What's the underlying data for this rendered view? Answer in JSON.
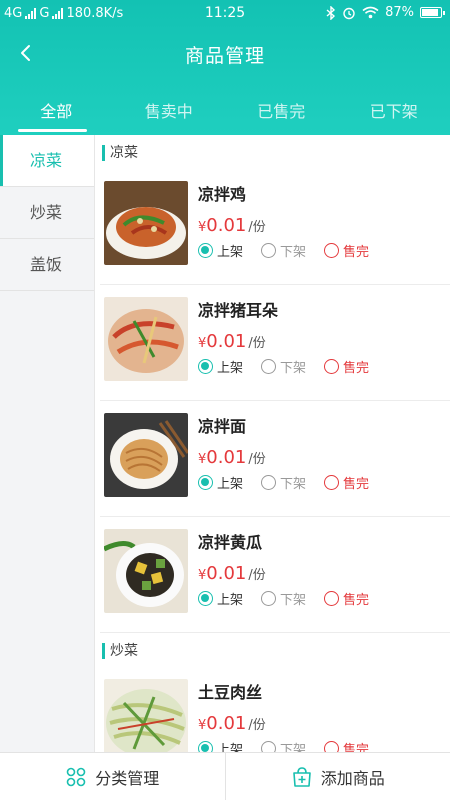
{
  "status_bar": {
    "carrier1": "4G",
    "carrier2": "G",
    "speed": "180.8K/s",
    "time": "11:25",
    "battery": "87%"
  },
  "nav": {
    "title": "商品管理"
  },
  "tabs": [
    {
      "label": "全部",
      "active": true
    },
    {
      "label": "售卖中",
      "active": false
    },
    {
      "label": "已售完",
      "active": false
    },
    {
      "label": "已下架",
      "active": false
    }
  ],
  "categories": [
    {
      "label": "凉菜",
      "active": true
    },
    {
      "label": "炒菜",
      "active": false
    },
    {
      "label": "盖饭",
      "active": false
    }
  ],
  "sections": [
    {
      "title": "凉菜",
      "items": [
        {
          "name": "凉拌鸡",
          "currency": "¥",
          "price": "0.01",
          "unit": "/份"
        },
        {
          "name": "凉拌猪耳朵",
          "currency": "¥",
          "price": "0.01",
          "unit": "/份"
        },
        {
          "name": "凉拌面",
          "currency": "¥",
          "price": "0.01",
          "unit": "/份"
        },
        {
          "name": "凉拌黄瓜",
          "currency": "¥",
          "price": "0.01",
          "unit": "/份"
        }
      ]
    },
    {
      "title": "炒菜",
      "items": [
        {
          "name": "土豆肉丝",
          "currency": "¥",
          "price": "0.01",
          "unit": "/份"
        }
      ]
    }
  ],
  "status_options": {
    "on": "上架",
    "off": "下架",
    "sold": "售完"
  },
  "bottom": {
    "category_manage": "分类管理",
    "add_product": "添加商品"
  },
  "colors": {
    "accent": "#18bfaf",
    "price": "#e4393c"
  }
}
